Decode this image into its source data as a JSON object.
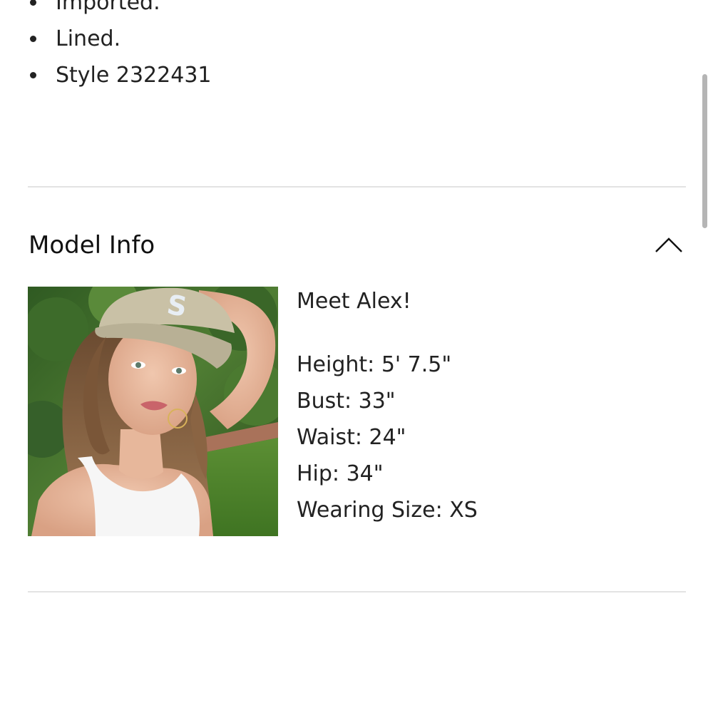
{
  "details": {
    "bullets": [
      {
        "text": "Imported."
      },
      {
        "text": "Lined."
      },
      {
        "text": "Style 2322431"
      }
    ]
  },
  "model_section": {
    "title": "Model Info",
    "toggle_icon": "chevron-up-icon",
    "photo_alt": "Model photo",
    "greeting": "Meet Alex!",
    "stats": [
      {
        "label": "Height: 5' 7.5\""
      },
      {
        "label": "Bust: 33\""
      },
      {
        "label": "Waist: 24\""
      },
      {
        "label": "Hip: 34\""
      },
      {
        "label": "Wearing Size: XS"
      }
    ]
  },
  "colors": {
    "text": "#222222",
    "divider": "#e3e3e3",
    "scrollbar": "#b5b5b5"
  }
}
